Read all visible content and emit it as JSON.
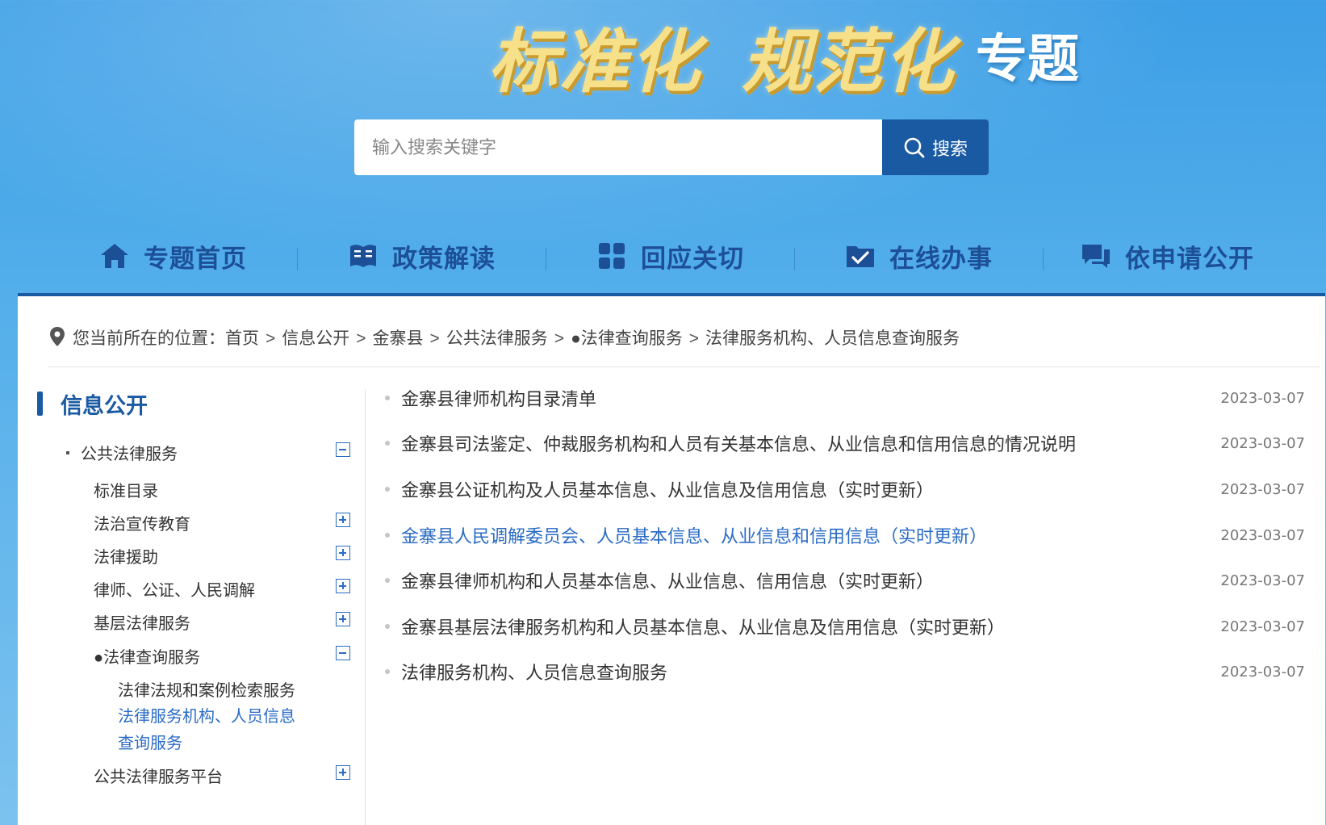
{
  "banner": {
    "title_part1": "标准化",
    "title_part2": "规范化",
    "title_part3": "专题"
  },
  "search": {
    "placeholder": "输入搜索关键字",
    "value": "",
    "button_label": "搜索"
  },
  "nav": {
    "items": [
      {
        "label": "专题首页",
        "icon": "home-icon"
      },
      {
        "label": "政策解读",
        "icon": "book-icon"
      },
      {
        "label": "回应关切",
        "icon": "grid-icon"
      },
      {
        "label": "在线办事",
        "icon": "folder-check-icon"
      },
      {
        "label": "依申请公开",
        "icon": "chat-icon"
      }
    ]
  },
  "colors": {
    "primary": "#1a5aa3",
    "link_active": "#2a6bc5",
    "banner_gold": "#f7e08a"
  },
  "breadcrumb": {
    "prefix": "您当前所在的位置：",
    "items": [
      "首页",
      "信息公开",
      "金寨县",
      "公共法律服务",
      "●法律查询服务",
      "法律服务机构、人员信息查询服务"
    ],
    "separator": ">"
  },
  "sidebar": {
    "title": "信息公开",
    "root": {
      "label": "公共法律服务",
      "toggle": "minus"
    },
    "items": [
      {
        "label": "标准目录",
        "toggle": ""
      },
      {
        "label": "法治宣传教育",
        "toggle": "plus"
      },
      {
        "label": "法律援助",
        "toggle": "plus"
      },
      {
        "label": "律师、公证、人民调解",
        "toggle": "plus"
      },
      {
        "label": "基层法律服务",
        "toggle": "plus"
      },
      {
        "label": "●法律查询服务",
        "toggle": "minus"
      }
    ],
    "subitems": [
      {
        "label": "法律法规和案例检索服务"
      },
      {
        "label_line1": "法律服务机构、人员信息",
        "label_line2": "查询服务"
      }
    ],
    "last_item": {
      "label": "公共法律服务平台",
      "toggle": "plus"
    }
  },
  "list": {
    "items": [
      {
        "title": "金寨县律师机构目录清单",
        "date": "2023-03-07"
      },
      {
        "title": "金寨县司法鉴定、仲裁服务机构和人员有关基本信息、从业信息和信用信息的情况说明",
        "date": "2023-03-07"
      },
      {
        "title": "金寨县公证机构及人员基本信息、从业信息及信用信息（实时更新）",
        "date": "2023-03-07"
      },
      {
        "title": "金寨县人民调解委员会、人员基本信息、从业信息和信用信息（实时更新）",
        "date": "2023-03-07"
      },
      {
        "title": "金寨县律师机构和人员基本信息、从业信息、信用信息（实时更新）",
        "date": "2023-03-07"
      },
      {
        "title": "金寨县基层法律服务机构和人员基本信息、从业信息及信用信息（实时更新）",
        "date": "2023-03-07"
      },
      {
        "title": "法律服务机构、人员信息查询服务",
        "date": "2023-03-07"
      }
    ]
  }
}
